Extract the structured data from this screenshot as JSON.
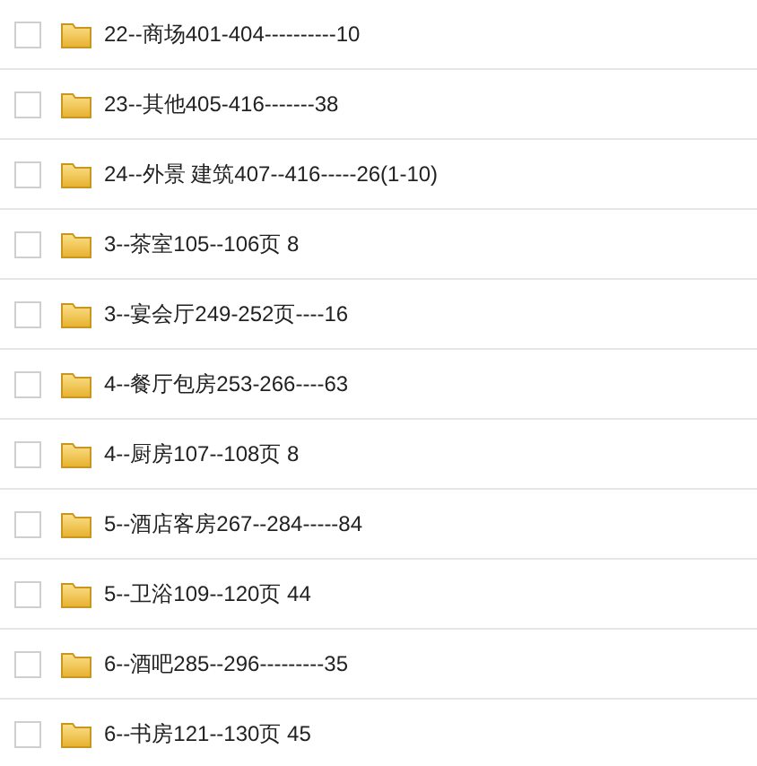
{
  "folders": [
    {
      "name": "22--商场401-404----------10",
      "checked": false
    },
    {
      "name": "23--其他405-416-------38",
      "checked": false
    },
    {
      "name": "24--外景 建筑407--416-----26(1-10)",
      "checked": false
    },
    {
      "name": "3--茶室105--106页 8",
      "checked": false
    },
    {
      "name": "3--宴会厅249-252页----16",
      "checked": false
    },
    {
      "name": "4--餐厅包房253-266----63",
      "checked": false
    },
    {
      "name": "4--厨房107--108页 8",
      "checked": false
    },
    {
      "name": "5--酒店客房267--284-----84",
      "checked": false
    },
    {
      "name": "5--卫浴109--120页 44",
      "checked": false
    },
    {
      "name": "6--酒吧285--296---------35",
      "checked": false
    },
    {
      "name": "6--书房121--130页 45",
      "checked": false
    }
  ]
}
